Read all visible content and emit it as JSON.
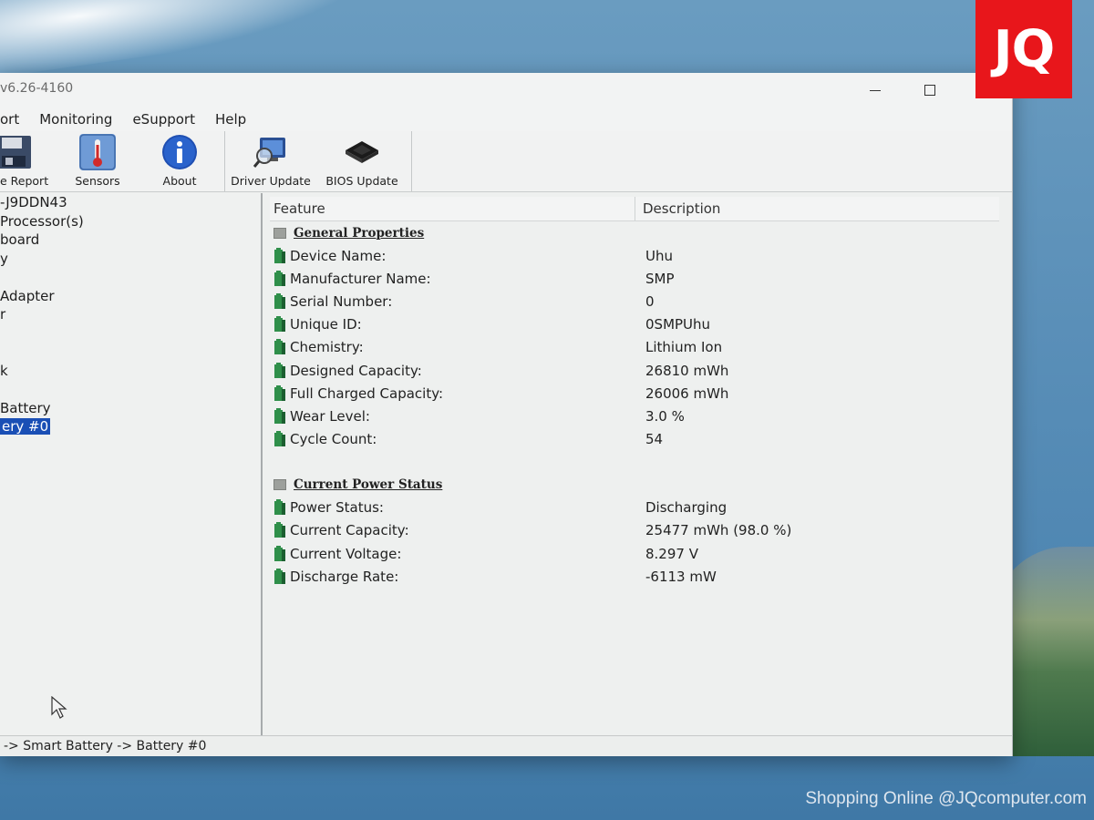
{
  "window": {
    "title": "v6.26-4160"
  },
  "menu": [
    "ort",
    "Monitoring",
    "eSupport",
    "Help"
  ],
  "toolbar": {
    "buttons": [
      "e Report",
      "Sensors",
      "About",
      "Driver Update",
      "BIOS Update"
    ]
  },
  "tree": {
    "items": [
      {
        "label": "-J9DDN43",
        "selected": false
      },
      {
        "label": " Processor(s)",
        "selected": false
      },
      {
        "label": "board",
        "selected": false
      },
      {
        "label": "y",
        "selected": false
      },
      {
        "label": "",
        "selected": false
      },
      {
        "label": "Adapter",
        "selected": false
      },
      {
        "label": "r",
        "selected": false
      },
      {
        "label": "",
        "selected": false
      },
      {
        "label": "",
        "selected": false
      },
      {
        "label": "k",
        "selected": false
      },
      {
        "label": "",
        "selected": false
      },
      {
        "label": "Battery",
        "selected": false
      },
      {
        "label": "ery #0",
        "selected": true
      }
    ]
  },
  "table": {
    "columns": [
      "Feature",
      "Description"
    ],
    "sections": [
      {
        "title": "General Properties",
        "rows": [
          {
            "feature": "Device Name:",
            "value": "Uhu"
          },
          {
            "feature": "Manufacturer Name:",
            "value": "SMP"
          },
          {
            "feature": "Serial Number:",
            "value": "0"
          },
          {
            "feature": "Unique ID:",
            "value": "0SMPUhu"
          },
          {
            "feature": "Chemistry:",
            "value": "Lithium Ion"
          },
          {
            "feature": "Designed Capacity:",
            "value": "26810 mWh"
          },
          {
            "feature": "Full Charged Capacity:",
            "value": "26006 mWh"
          },
          {
            "feature": "Wear Level:",
            "value": "3.0 %"
          },
          {
            "feature": "Cycle Count:",
            "value": "54"
          }
        ]
      },
      {
        "title": "Current Power Status",
        "rows": [
          {
            "feature": "Power Status:",
            "value": "Discharging"
          },
          {
            "feature": "Current Capacity:",
            "value": "25477 mWh (98.0 %)"
          },
          {
            "feature": "Current Voltage:",
            "value": "8.297 V"
          },
          {
            "feature": "Discharge Rate:",
            "value": "-6113 mW"
          }
        ]
      }
    ]
  },
  "statusbar": {
    "path": "-> Smart Battery -> Battery #0"
  },
  "overlay": {
    "logo_text": "JQ",
    "watermark": "Shopping Online @JQcomputer.com"
  },
  "colors": {
    "selection": "#1a4fb5",
    "logo_bg": "#e8161b",
    "battery_icon": "#2f8f4a"
  },
  "icons": {
    "toolbar": [
      "floppy-disk-icon",
      "thermometer-icon",
      "info-icon",
      "monitor-magnifier-icon",
      "chip-icon"
    ],
    "row": "battery-icon",
    "section": "section-bullet-icon",
    "window_controls": [
      "minimize-icon",
      "maximize-icon",
      "close-icon"
    ],
    "cursor": "mouse-pointer-icon"
  }
}
